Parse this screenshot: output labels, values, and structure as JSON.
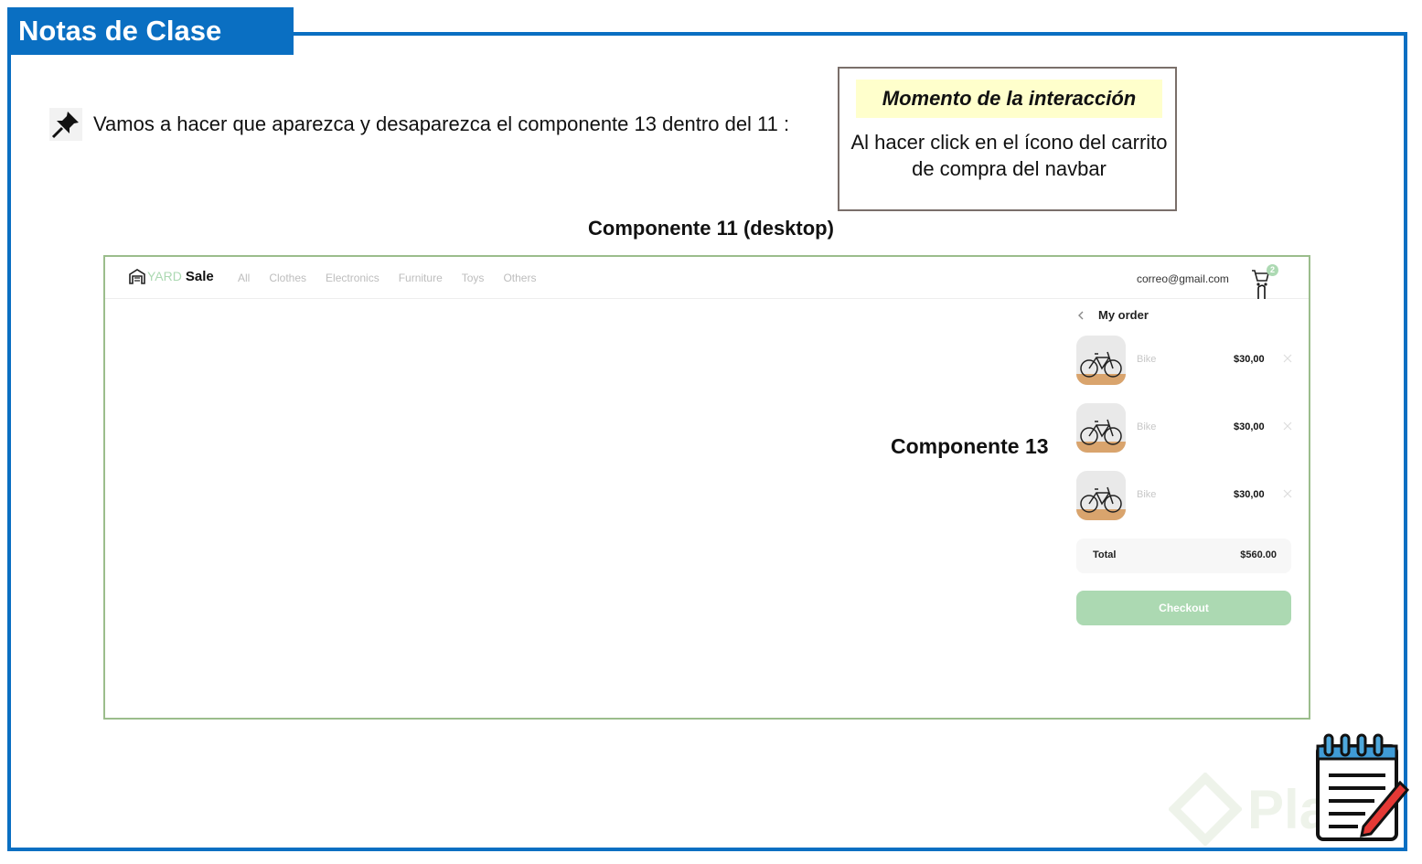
{
  "header": {
    "title": "Notas de Clase"
  },
  "note": {
    "text": "Vamos a hacer que aparezca y desaparezca el componente 13 dentro del 11 :"
  },
  "moment": {
    "title": "Momento de la interacción",
    "body": "Al hacer click en el ícono del carrito de compra del navbar"
  },
  "component11": {
    "title": "Componente 11 (desktop)"
  },
  "component13": {
    "label": "Componente 13"
  },
  "mock": {
    "logo": {
      "yard": "YARD",
      "sale": "Sale"
    },
    "menu": [
      "All",
      "Clothes",
      "Electronics",
      "Furniture",
      "Toys",
      "Others"
    ],
    "email": "correo@gmail.com",
    "cart_count": "2",
    "order": {
      "title": "My order",
      "items": [
        {
          "name": "Bike",
          "price": "$30,00"
        },
        {
          "name": "Bike",
          "price": "$30,00"
        },
        {
          "name": "Bike",
          "price": "$30,00"
        }
      ],
      "total_label": "Total",
      "total_value": "$560.00",
      "checkout_label": "Checkout"
    }
  },
  "watermark": {
    "text": "Platzi"
  },
  "colors": {
    "frame": "#0a6fc2",
    "accent_green": "#acd9b2",
    "highlight": "#ffffcc",
    "mock_border": "#9bbd8c"
  }
}
